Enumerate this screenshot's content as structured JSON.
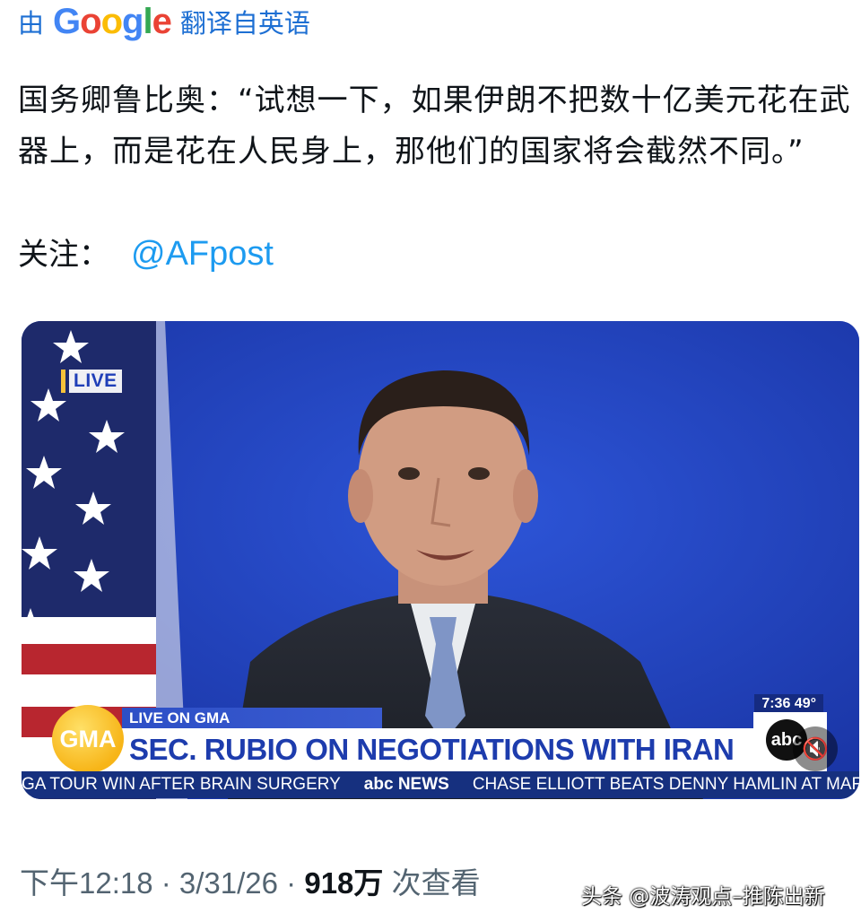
{
  "translate_bar": {
    "prefix": "由",
    "logo": "Google",
    "suffix": "翻译自英语"
  },
  "tweet": {
    "text": "国务卿鲁比奥：“试想一下，如果伊朗不把数十亿美元花在武器上，而是花在人民身上，那他们的国家将会截然不同。”",
    "follow_label": "关注：",
    "follow_handle": "@AFpost"
  },
  "video": {
    "live_tag": "LIVE",
    "clock": "7:36  49°",
    "live_on": "LIVE ON GMA",
    "gma_logo": "GMA",
    "headline": "SEC. RUBIO ON NEGOTIATIONS WITH IRAN",
    "abc_logo": "abc",
    "ticker": [
      "GA TOUR WIN AFTER BRAIN SURGERY",
      "abc NEWS",
      "CHASE ELLIOTT BEATS DENNY HAMLIN AT MARTINSVILL"
    ],
    "mute_icon": "mute-icon"
  },
  "meta": {
    "time": "下午12:18 · 3/31/26 · ",
    "views": "918万",
    "views_label": " 次查看"
  },
  "watermark": "头条 @波涛观点–推陈出新",
  "colors": {
    "link": "#1d9bf0",
    "translate": "#1d6fd3",
    "video_bg": "#1f3fb8",
    "headline_text": "#1d3cad",
    "gma_yellow": "#f7b518"
  }
}
